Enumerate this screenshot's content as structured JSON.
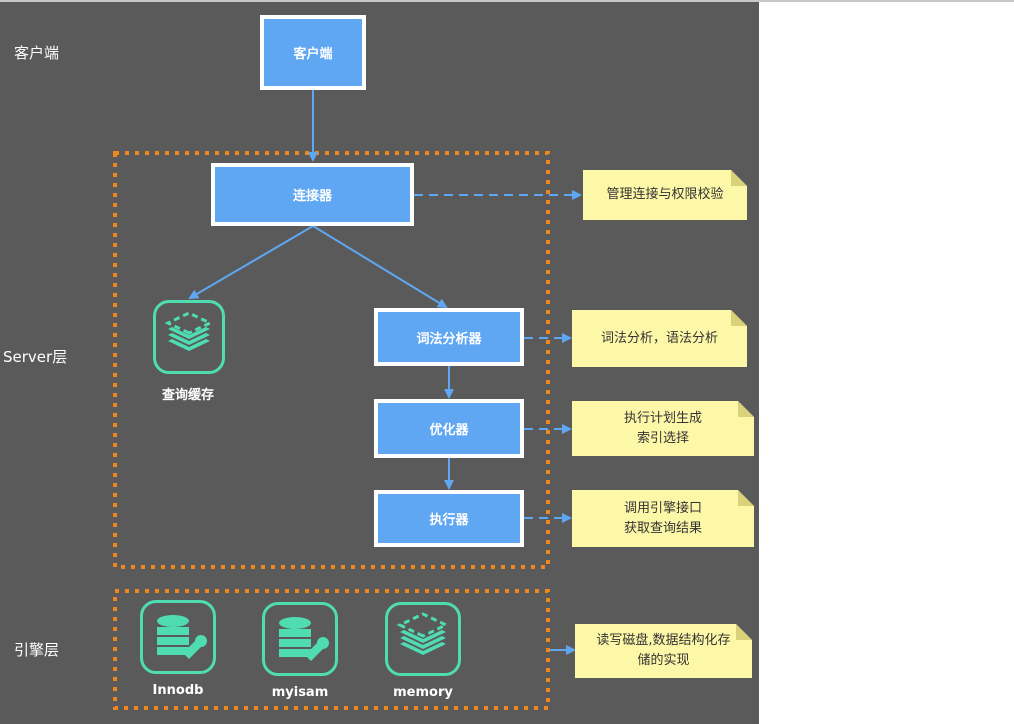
{
  "layers": {
    "client": "客户端",
    "server": "Server层",
    "engine": "引擎层"
  },
  "nodes": {
    "client": "客户端",
    "connector": "连接器",
    "lexer": "词法分析器",
    "optimizer": "优化器",
    "executor": "执行器"
  },
  "cache": {
    "label": "查询缓存",
    "icon": "stack-layers-icon"
  },
  "engines": [
    {
      "label": "Innodb",
      "icon": "database-wrench-icon"
    },
    {
      "label": "myisam",
      "icon": "database-wrench-icon"
    },
    {
      "label": "memory",
      "icon": "stack-layers-icon"
    }
  ],
  "notes": {
    "connector": [
      "管理连接与权限校验"
    ],
    "lexer": [
      "词法分析，语法分析"
    ],
    "optimizer": [
      "执行计划生成",
      "索引选择"
    ],
    "executor": [
      "调用引擎接口",
      "获取查询结果"
    ],
    "engine": [
      "读写磁盘,数据结构化存",
      "储的实现"
    ]
  },
  "colors": {
    "background": "#5a5a5a",
    "node_fill": "#5fa7f2",
    "arrow": "#5fa7f2",
    "group_border": "#f0871e",
    "note_fill": "#fdf7a8",
    "icon": "#4fdcb0"
  }
}
